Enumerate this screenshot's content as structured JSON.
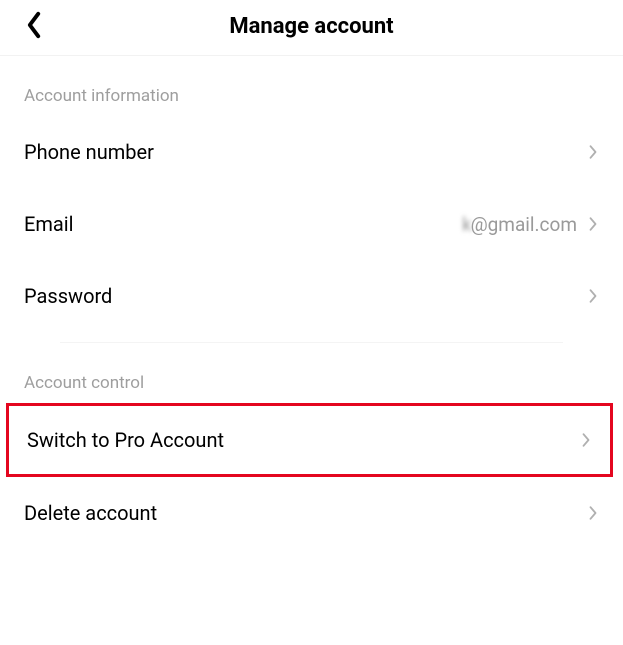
{
  "header": {
    "title": "Manage account"
  },
  "sections": {
    "info": {
      "label": "Account information",
      "phone": {
        "label": "Phone number"
      },
      "email": {
        "label": "Email",
        "value_obscured": "k",
        "value_suffix": "@gmail.com"
      },
      "password": {
        "label": "Password"
      }
    },
    "control": {
      "label": "Account control",
      "switch_pro": {
        "label": "Switch to Pro Account"
      },
      "delete": {
        "label": "Delete account"
      }
    }
  }
}
